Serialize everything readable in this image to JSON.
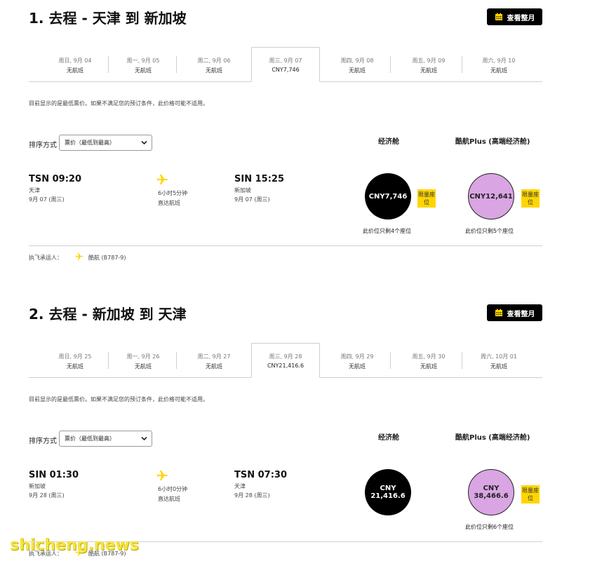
{
  "colors": {
    "accent": "#ffd500",
    "economy_circle": "#000000",
    "plus_circle": "#d9a5e3"
  },
  "sections": [
    {
      "title": "1. 去程 - 天津 到 新加坡",
      "calendar_button": "查看整月",
      "tabs": [
        {
          "date": "周日, 9月 04",
          "price": "无航班"
        },
        {
          "date": "周一, 9月 05",
          "price": "无航班"
        },
        {
          "date": "周二, 9月 06",
          "price": "无航班"
        },
        {
          "date": "周三, 9月 07",
          "price": "CNY7,746"
        },
        {
          "date": "周四, 9月 08",
          "price": "无航班"
        },
        {
          "date": "周五, 9月 09",
          "price": "无航班"
        },
        {
          "date": "周六, 9月 10",
          "price": "无航班"
        }
      ],
      "active_tab": 3,
      "note": "目前显示的是最低票价。如果不满足您的预订条件，此价格可能不适用。",
      "sort_label": "排序方式",
      "sort_value": "票价（最低到最高）",
      "cabin_economy": "经济舱",
      "cabin_plus": "酷航Plus (高端经济舱)",
      "flight": {
        "dep_code": "TSN 09:20",
        "dep_city": "天津",
        "dep_date": "9月 07 (周三)",
        "duration": "6小时5分钟",
        "direct": "直达航班",
        "arr_code": "SIN 15:25",
        "arr_city": "新加坡",
        "arr_date": "9月 07 (周三)"
      },
      "economy_price_line1": "CNY7,746",
      "economy_price_line2": "",
      "plus_price_line1": "CNY12,641",
      "plus_price_line2": "",
      "ribbon": "限量座位",
      "economy_seat_note": "此价位只剩4个座位",
      "plus_seat_note": "此价位只剩5个座位",
      "operator_label": "执飞承运人：",
      "operator_name": "酷航 (B787-9)"
    },
    {
      "title": "2. 去程 - 新加坡 到 天津",
      "calendar_button": "查看整月",
      "tabs": [
        {
          "date": "周日, 9月 25",
          "price": "无航班"
        },
        {
          "date": "周一, 9月 26",
          "price": "无航班"
        },
        {
          "date": "周二, 9月 27",
          "price": "无航班"
        },
        {
          "date": "周三, 9月 28",
          "price": "CNY21,416.6"
        },
        {
          "date": "周四, 9月 29",
          "price": "无航班"
        },
        {
          "date": "周五, 9月 30",
          "price": "无航班"
        },
        {
          "date": "周六, 10月 01",
          "price": "无航班"
        }
      ],
      "active_tab": 3,
      "note": "目前显示的是最低票价。如果不满足您的预订条件，此价格可能不适用。",
      "sort_label": "排序方式",
      "sort_value": "票价（最低到最高）",
      "cabin_economy": "经济舱",
      "cabin_plus": "酷航Plus (高端经济舱)",
      "flight": {
        "dep_code": "SIN 01:30",
        "dep_city": "新加坡",
        "dep_date": "9月 28 (周三)",
        "duration": "6小时0分钟",
        "direct": "直达航班",
        "arr_code": "TSN 07:30",
        "arr_city": "天津",
        "arr_date": "9月 28 (周三)"
      },
      "economy_price_line1": "CNY",
      "economy_price_line2": "21,416.6",
      "plus_price_line1": "CNY",
      "plus_price_line2": "38,466.6",
      "ribbon": "限量座位",
      "economy_seat_note": "",
      "plus_seat_note": "此价位只剩6个座位",
      "operator_label": "执飞承运人：",
      "operator_name": "酷航 (B787-9)"
    }
  ],
  "watermark": "shicheng.news"
}
